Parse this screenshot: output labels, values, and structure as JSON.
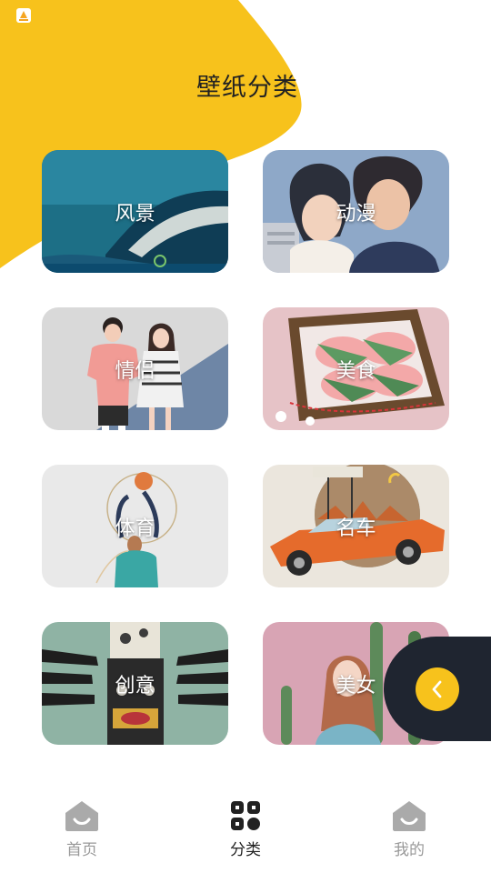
{
  "app_icon": "app-store-icon",
  "page_title": "壁纸分类",
  "categories": [
    {
      "label": "风景",
      "image": "coastal-landscape"
    },
    {
      "label": "动漫",
      "image": "anime-couple"
    },
    {
      "label": "情侣",
      "image": "couple-illustration"
    },
    {
      "label": "美食",
      "image": "sakura-mochi-box"
    },
    {
      "label": "体育",
      "image": "basketball-player"
    },
    {
      "label": "名车",
      "image": "orange-classic-car"
    },
    {
      "label": "创意",
      "image": "tiki-totem-hands"
    },
    {
      "label": "美女",
      "image": "girl-with-cactus"
    }
  ],
  "back_button_icon": "chevron-left-icon",
  "tabs": [
    {
      "label": "首页",
      "icon": "home-icon",
      "active": false
    },
    {
      "label": "分类",
      "icon": "category-grid-icon",
      "active": true
    },
    {
      "label": "我的",
      "icon": "profile-icon",
      "active": false
    }
  ],
  "colors": {
    "accent_yellow": "#f7c21c",
    "panel_dark": "#1f2530",
    "tab_active": "#222222",
    "tab_inactive": "#999999"
  }
}
